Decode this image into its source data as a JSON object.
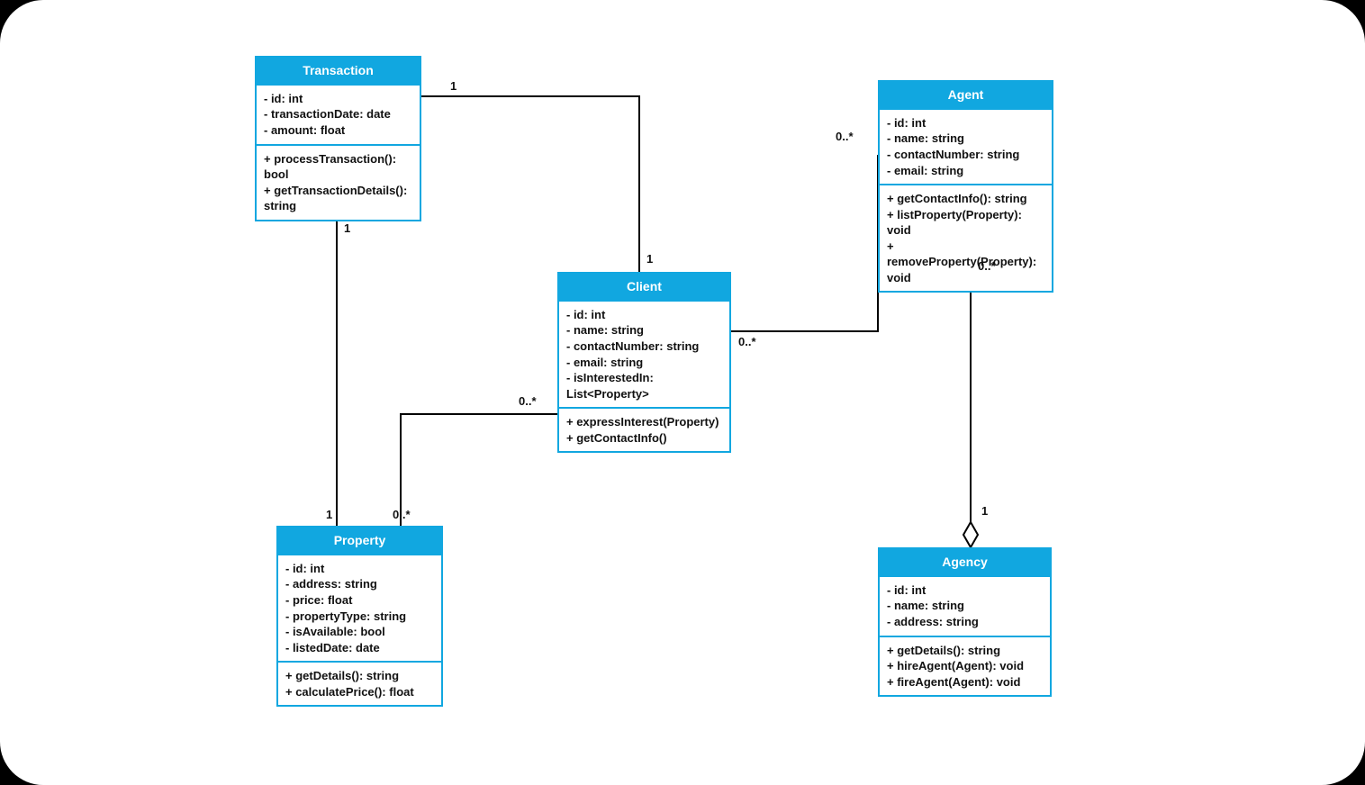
{
  "classes": {
    "transaction": {
      "title": "Transaction",
      "attrs": [
        "- id: int",
        "- transactionDate: date",
        "- amount: float"
      ],
      "methods": [
        "+ processTransaction(): bool",
        "+ getTransactionDetails(): string"
      ]
    },
    "client": {
      "title": "Client",
      "attrs": [
        "- id: int",
        "- name: string",
        "- contactNumber: string",
        "- email: string",
        "- isInterestedIn: List<Property>"
      ],
      "methods": [
        "+ expressInterest(Property)",
        "+ getContactInfo()"
      ]
    },
    "agent": {
      "title": "Agent",
      "attrs": [
        "- id: int",
        "- name: string",
        "- contactNumber: string",
        "- email: string"
      ],
      "methods": [
        "+ getContactInfo(): string",
        "+ listProperty(Property): void",
        "+ removeProperty(Property): void"
      ]
    },
    "property": {
      "title": "Property",
      "attrs": [
        "- id: int",
        "- address: string",
        "- price: float",
        "- propertyType: string",
        "- isAvailable: bool",
        "- listedDate: date"
      ],
      "methods": [
        "+ getDetails(): string",
        "+ calculatePrice(): float"
      ]
    },
    "agency": {
      "title": "Agency",
      "attrs": [
        "- id: int",
        "- name: string",
        "- address: string"
      ],
      "methods": [
        "+ getDetails(): string",
        "+ hireAgent(Agent): void",
        "+ fireAgent(Agent): void"
      ]
    }
  },
  "mult": {
    "trans_top": "1",
    "trans_bottom": "1",
    "client_top": "1",
    "client_right_near": "0..*",
    "client_left": "0..*",
    "agent_left": "0..*",
    "agent_bottom": "0..*",
    "agency_top": "1",
    "property_one": "1",
    "property_many": "0..*"
  },
  "colors": {
    "primary": "#11a7e0"
  }
}
